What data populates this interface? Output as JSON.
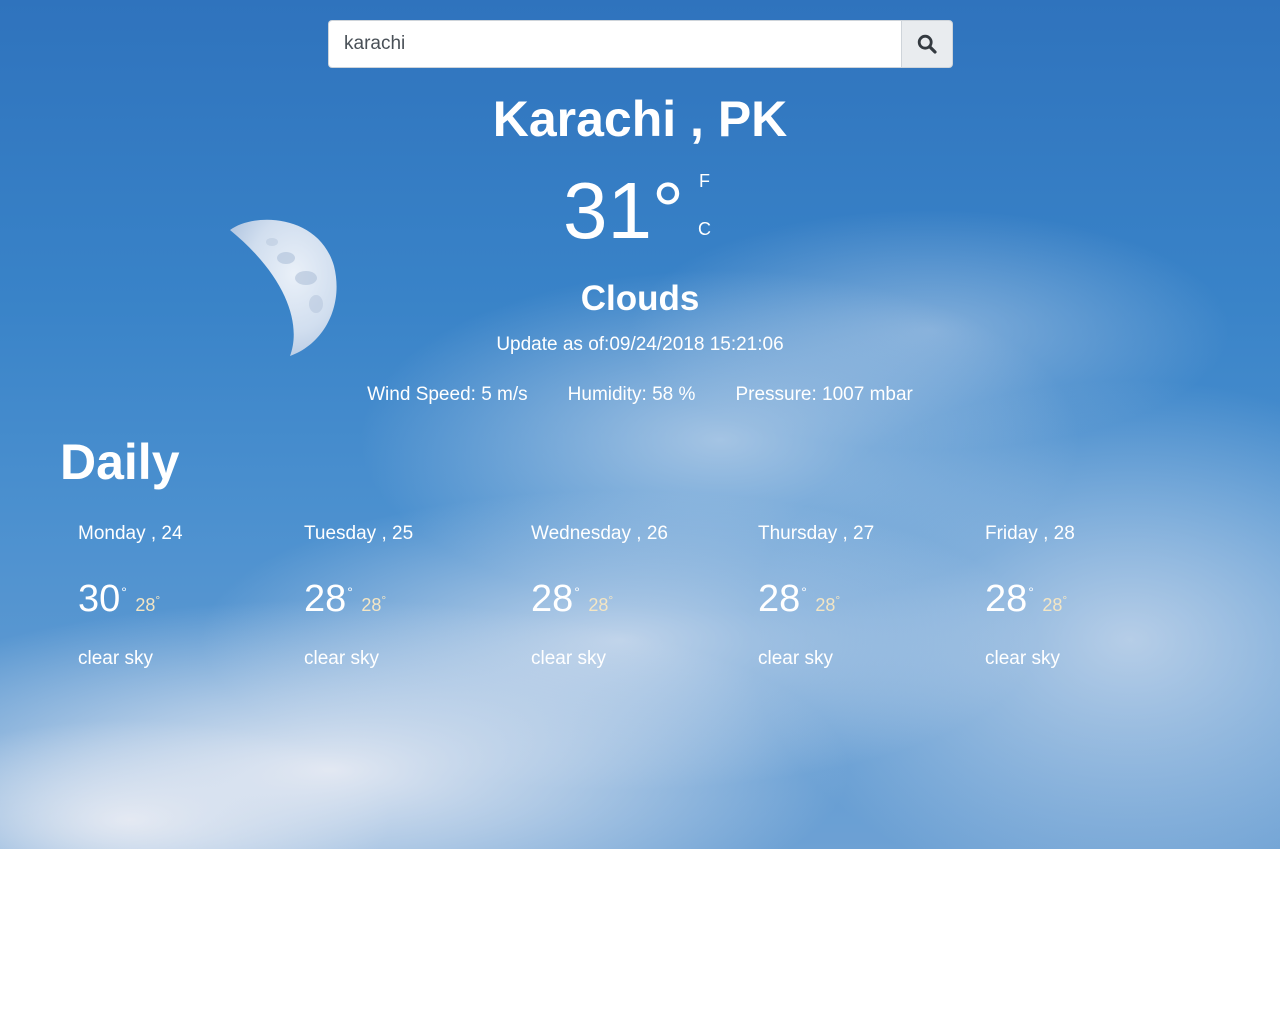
{
  "search": {
    "value": "karachi",
    "button_icon": "search-icon"
  },
  "current": {
    "location": "Karachi , PK",
    "temperature": "31°",
    "unit_f": "F",
    "unit_c": "C",
    "condition": "Clouds",
    "updated": "Update as of:09/24/2018 15:21:06",
    "wind": "Wind Speed: 5 m/s",
    "humidity": "Humidity: 58 %",
    "pressure": "Pressure: 1007 mbar"
  },
  "daily": {
    "title": "Daily",
    "days": [
      {
        "name": "Monday , 24",
        "high": "30",
        "low": "28",
        "deg": "°",
        "desc": "clear sky"
      },
      {
        "name": "Tuesday , 25",
        "high": "28",
        "low": "28",
        "deg": "°",
        "desc": "clear sky"
      },
      {
        "name": "Wednesday , 26",
        "high": "28",
        "low": "28",
        "deg": "°",
        "desc": "clear sky"
      },
      {
        "name": "Thursday , 27",
        "high": "28",
        "low": "28",
        "deg": "°",
        "desc": "clear sky"
      },
      {
        "name": "Friday , 28",
        "high": "28",
        "low": "28",
        "deg": "°",
        "desc": "clear sky"
      }
    ]
  },
  "colors": {
    "sky_top": "#2f73bd",
    "sky_bottom": "#6da1d4",
    "text": "#ffffff",
    "low_temp": "#f4e6c4"
  }
}
